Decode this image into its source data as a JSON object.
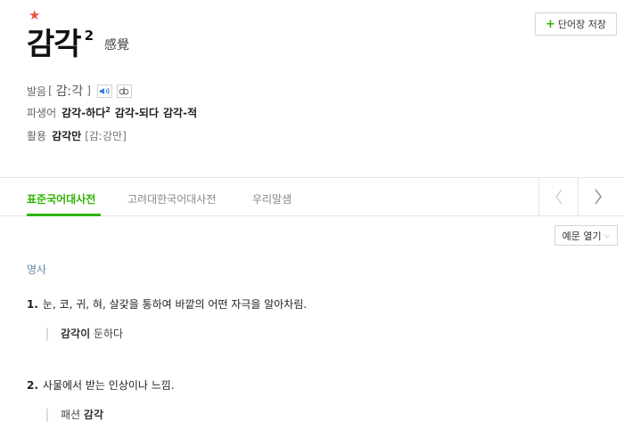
{
  "entry": {
    "star": "★",
    "headword": "감각",
    "homonym_number": "2",
    "hanja": "感覺"
  },
  "save_button": {
    "plus": "+",
    "label": "단어장 저장"
  },
  "pronunciation": {
    "label": "발음",
    "open_bracket": "[",
    "text": "감ː각",
    "close_bracket": "]",
    "speaker_icon": "speaker-icon",
    "play_icon": "loop-icon"
  },
  "derivatives": {
    "label": "파생어",
    "items": [
      {
        "text": "감각-하다",
        "sup": "2"
      },
      {
        "text": "감각-되다",
        "sup": ""
      },
      {
        "text": "감각-적",
        "sup": ""
      }
    ]
  },
  "usage": {
    "label": "활용",
    "word": "감각만",
    "pron": "[감ː강만]"
  },
  "tabs": [
    {
      "label": "표준국어대사전",
      "active": true
    },
    {
      "label": "고려대한국어대사전",
      "active": false
    },
    {
      "label": "우리말샘",
      "active": false
    }
  ],
  "nav": {
    "prev_icon": "chevron-left-icon",
    "next_icon": "chevron-right-icon"
  },
  "examples_button": {
    "label": "예문 열기",
    "chevron": "⌵"
  },
  "part_of_speech": "명사",
  "senses": [
    {
      "num": "1.",
      "definition": "눈, 코, 귀, 혀, 살갗을 통하여 바깥의 어떤 자극을 알아차림.",
      "example_pre": "",
      "example_bold": "감각이",
      "example_post": " 둔하다"
    },
    {
      "num": "2.",
      "definition": "사물에서 받는 인상이나 느낌.",
      "example_pre": "패션 ",
      "example_bold": "감각",
      "example_post": ""
    }
  ],
  "colors": {
    "accent_green": "#2db400",
    "star_red": "#e8533f",
    "pos_blue": "#6688aa"
  }
}
